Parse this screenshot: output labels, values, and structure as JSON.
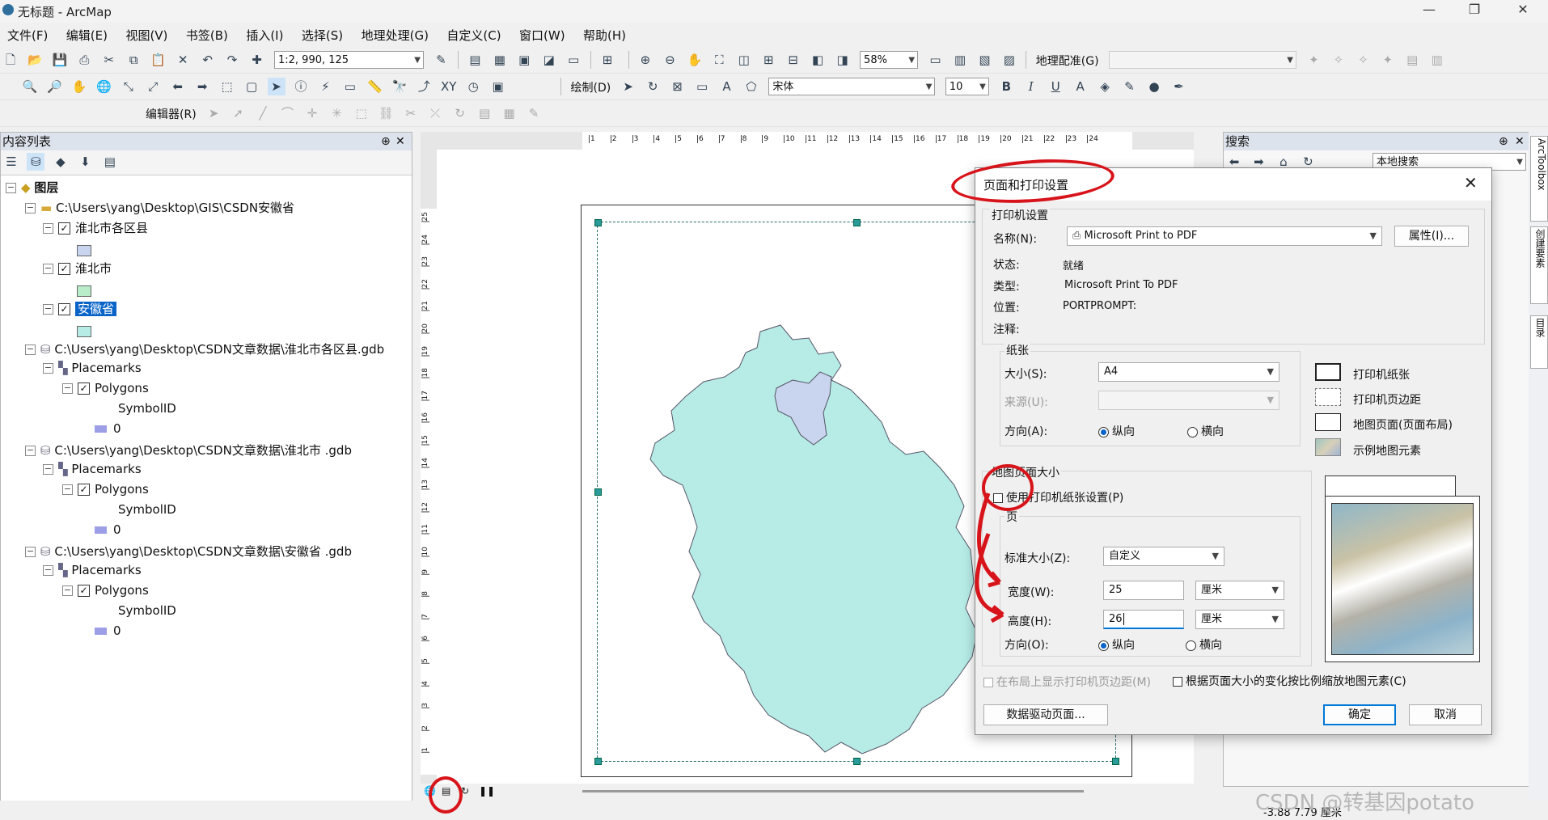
{
  "window": {
    "title": "无标题 - ArcMap",
    "controls": [
      "—",
      "❐",
      "✕"
    ]
  },
  "menu": [
    "文件(F)",
    "编辑(E)",
    "视图(V)",
    "书签(B)",
    "插入(I)",
    "选择(S)",
    "地理处理(G)",
    "自定义(C)",
    "窗口(W)",
    "帮助(H)"
  ],
  "toolbar": {
    "scale": "1:2, 990, 125",
    "zoom": "58%",
    "georef": "地理配准(G)",
    "draw": "绘制(D)",
    "font": "宋体",
    "fontsize": "10",
    "bold": "B",
    "italic": "I",
    "underline": "U",
    "editor": "编辑器(R)"
  },
  "toc": {
    "header": "内容列表",
    "pin": "⊕",
    "close": "✕",
    "root": "图层",
    "items": [
      {
        "label": "C:\\Users\\yang\\Desktop\\GIS\\CSDN安徽省"
      },
      {
        "label": "淮北市各区县"
      },
      {
        "label": "淮北市"
      },
      {
        "label": "安徽省"
      },
      {
        "label": "C:\\Users\\yang\\Desktop\\CSDN文章数据\\淮北市各区县.gdb"
      },
      {
        "label": "Placemarks"
      },
      {
        "label": "Polygons"
      },
      {
        "label": "SymbolID"
      },
      {
        "label": "0"
      },
      {
        "label": "C:\\Users\\yang\\Desktop\\CSDN文章数据\\淮北市 .gdb"
      },
      {
        "label": "Placemarks"
      },
      {
        "label": "Polygons"
      },
      {
        "label": "SymbolID"
      },
      {
        "label": "0"
      },
      {
        "label": "C:\\Users\\yang\\Desktop\\CSDN文章数据\\安徽省 .gdb"
      },
      {
        "label": "Placemarks"
      },
      {
        "label": "Polygons"
      },
      {
        "label": "SymbolID"
      },
      {
        "label": "0"
      }
    ]
  },
  "ruler": {
    "ticks": [
      "1",
      "2",
      "3",
      "4",
      "5",
      "6",
      "7",
      "8",
      "9",
      "10",
      "11",
      "12",
      "13",
      "14",
      "15",
      "16",
      "17",
      "18",
      "19",
      "20",
      "21",
      "22",
      "23",
      "24"
    ],
    "vticks": [
      "25",
      "24",
      "23",
      "22",
      "21",
      "20",
      "19",
      "18",
      "17",
      "16",
      "15",
      "14",
      "13",
      "12",
      "11",
      "10",
      "9",
      "8",
      "7",
      "6",
      "5",
      "4",
      "3",
      "2",
      "1"
    ]
  },
  "search": {
    "header": "搜索",
    "scope": "本地搜索"
  },
  "side_tabs": [
    "ArcToolbox",
    "创建要素",
    "目录"
  ],
  "status": {
    "coords": "-3.88  7.79 厘米"
  },
  "watermark": "CSDN @转基因potato",
  "colors": {
    "province": "#b6ebe6",
    "district": "#c9d4ee",
    "accent": "#0078d7",
    "annotation": "#d8141b"
  },
  "dialog": {
    "title": "页面和打印设置",
    "printer_section": "打印机设置",
    "name_label": "名称(N):",
    "name_value": "Microsoft Print to PDF",
    "properties_btn": "属性(I)...",
    "status_label": "状态:",
    "status_value": "就绪",
    "type_label": "类型:",
    "type_value": "Microsoft Print To PDF",
    "location_label": "位置:",
    "location_value": "PORTPROMPT:",
    "comment_label": "注释:",
    "paper_section": "纸张",
    "size_label": "大小(S):",
    "size_value": "A4",
    "source_label": "来源(U):",
    "orient_label": "方向(A):",
    "portrait": "纵向",
    "landscape": "横向",
    "legend": [
      "打印机纸张",
      "打印机页边距",
      "地图页面(页面布局)",
      "示例地图元素"
    ],
    "mappage_section": "地图页面大小",
    "use_printer_cb": "使用打印机纸张设置(P)",
    "page_section": "页",
    "std_size_label": "标准大小(Z):",
    "std_size_value": "自定义",
    "width_label": "宽度(W):",
    "width_value": "25",
    "width_unit": "厘米",
    "height_label": "高度(H):",
    "height_value": "26",
    "height_unit": "厘米",
    "orient2_label": "方向(O):",
    "show_margins_cb": "在布局上显示打印机页边距(M)",
    "scale_elements_cb": "根据页面大小的变化按比例缩放地图元素(C)",
    "ddp_btn": "数据驱动页面...",
    "ok_btn": "确定",
    "cancel_btn": "取消"
  }
}
